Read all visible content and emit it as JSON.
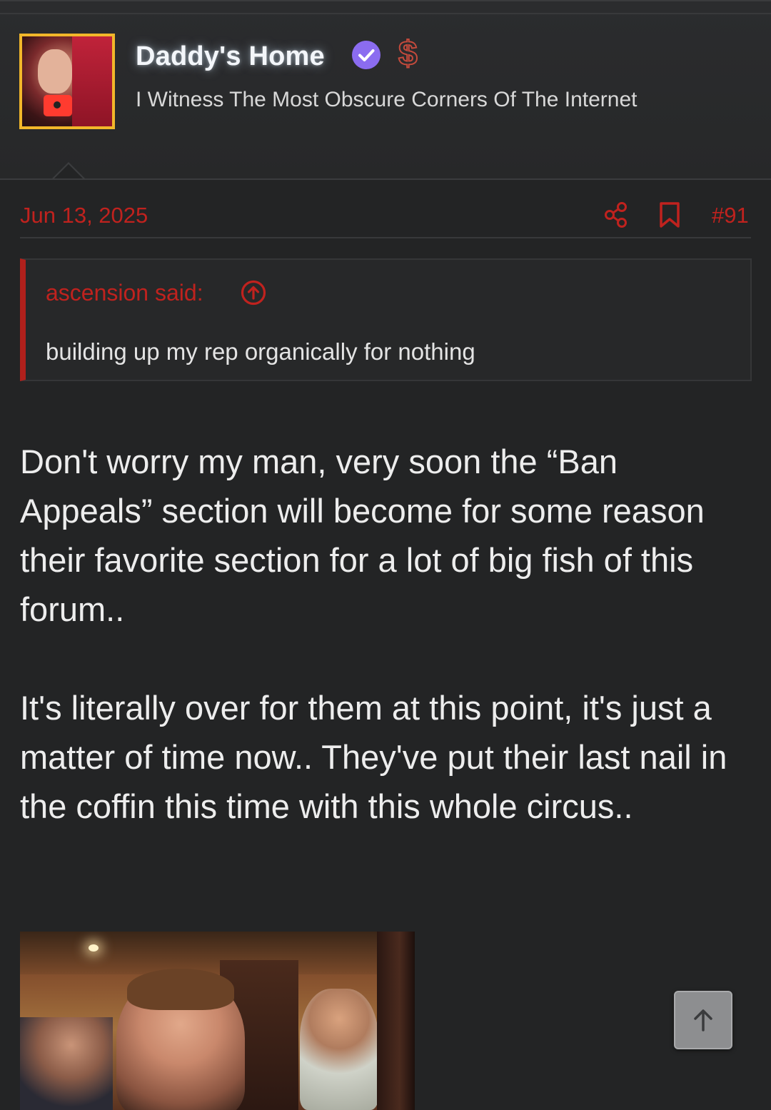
{
  "author": {
    "username": "Daddy's Home",
    "user_title": "I Witness The Most Obscure Corners Of The Internet",
    "avatar_icon": "user-avatar",
    "badges": [
      "verified-icon",
      "dollar-icon"
    ],
    "username_color": "#f3f6fa",
    "avatar_border_color": "#f2b72a",
    "verified_color": "#8b6cf0"
  },
  "post": {
    "date": "Jun 13, 2025",
    "number": "#91",
    "accent_color": "#c0221e",
    "actions": [
      "share-icon",
      "bookmark-icon"
    ]
  },
  "quote": {
    "author_label": "ascension said:",
    "text": "building up my rep organically for nothing"
  },
  "body": {
    "paragraph_1": "Don't worry my man, very soon the “Ban Appeals” section will become for some reason their favorite section for a lot of big fish of this forum..",
    "paragraph_2": "It's literally over for them at this point, it's just a matter of time now.. They've put their last nail in the coffin this time with this whole circus.."
  },
  "attachment": {
    "type": "image"
  },
  "controls": {
    "scroll_top_icon": "arrow-up-icon"
  }
}
